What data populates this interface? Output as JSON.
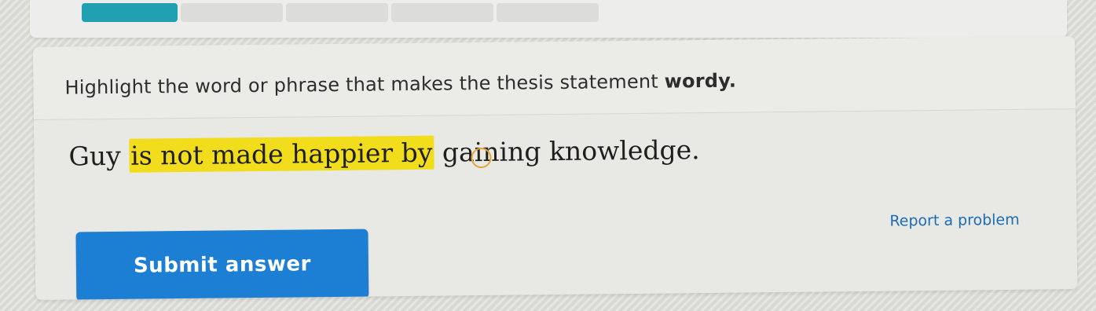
{
  "prompt": {
    "text_before": "Highlight the word or phrase that makes the thesis statement ",
    "bold_word": "wordy."
  },
  "sentence": {
    "lead": "Guy ",
    "highlighted": "is not made happier by",
    "trail": " gaining knowledge."
  },
  "actions": {
    "submit_label": "Submit answer",
    "report_label": "Report a problem"
  },
  "colors": {
    "highlight": "#f2dd1c",
    "submit_button": "#1c7fd3",
    "progress": "#21a0b4",
    "report_link": "#1d6db5"
  }
}
